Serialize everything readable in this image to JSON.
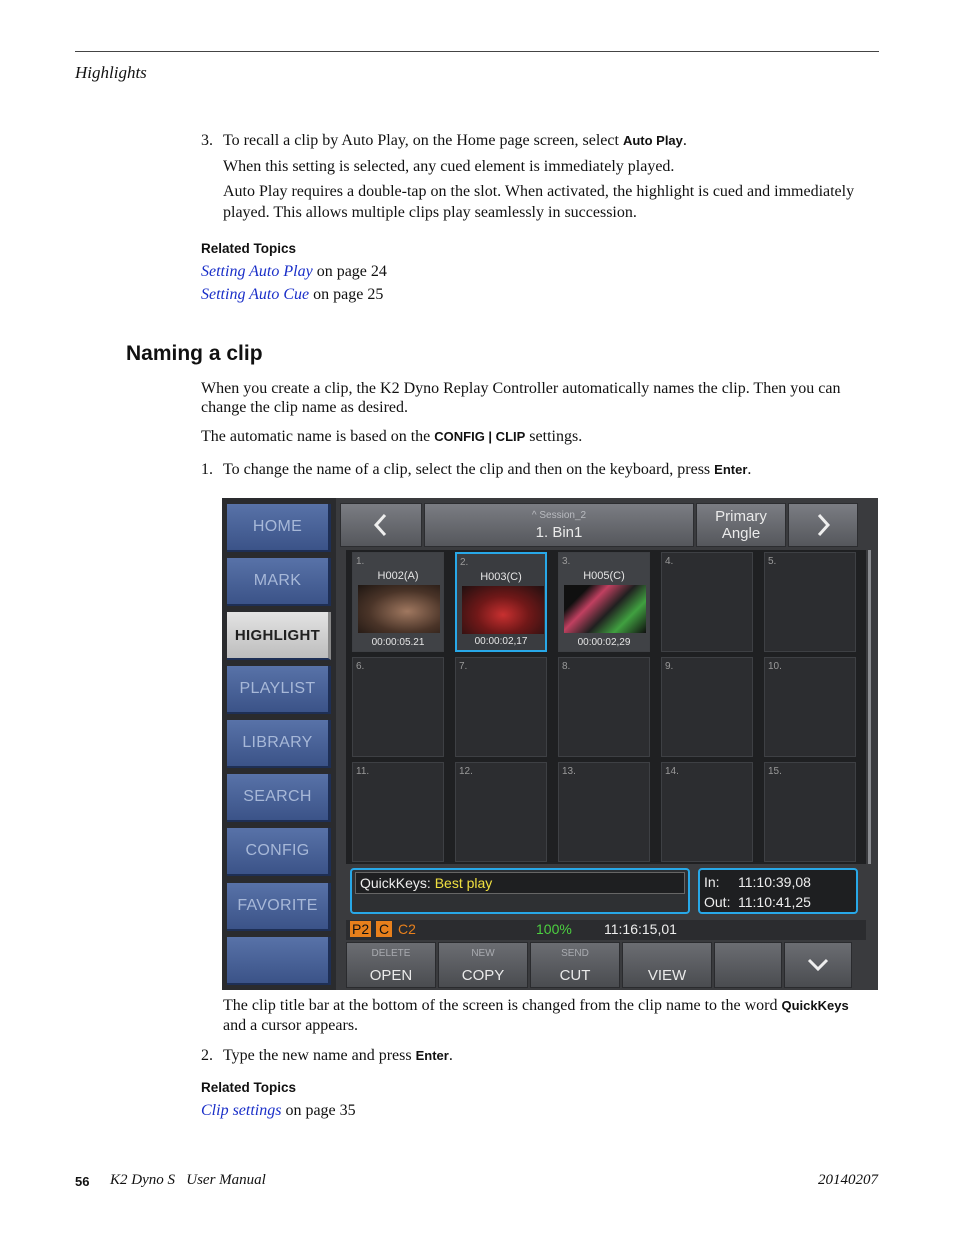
{
  "header": {
    "section": "Highlights"
  },
  "step3": {
    "num": "3.",
    "text_pre": "To recall a clip by Auto Play, on the Home page screen, select ",
    "text_kw": "Auto Play",
    "text_post": ".",
    "line2": "When this setting is selected, any cued element is immediately played.",
    "line3a": "Auto Play requires a double-tap on the slot. When activated, the highlight is cued and immediately",
    "line3b": "played. This allows multiple clips play seamlessly in succession."
  },
  "related1": {
    "title": "Related Topics",
    "links": [
      {
        "text": "Setting Auto Play",
        "suffix": " on page 24"
      },
      {
        "text": "Setting Auto Cue",
        "suffix": " on page 25"
      }
    ]
  },
  "heading": "Naming a clip",
  "intro": {
    "p1a": "When you create a clip, the K2 Dyno Replay Controller automatically names the clip. Then you can",
    "p1b": "change the clip name as desired.",
    "p2_pre": "The automatic name is based on the ",
    "p2_kw": "CONFIG | CLIP",
    "p2_post": " settings."
  },
  "step1": {
    "num": "1.",
    "text_pre": "To change the name of a clip, select the clip and then on the keyboard, press ",
    "text_kw": "Enter",
    "text_post": "."
  },
  "screenshot": {
    "nav": [
      "HOME",
      "MARK",
      "HIGHLIGHT",
      "PLAYLIST",
      "LIBRARY",
      "SEARCH",
      "CONFIG",
      "FAVORITE",
      ""
    ],
    "active_nav": "HIGHLIGHT",
    "session": "^ Session_2",
    "bin": "1. Bin1",
    "angle_line1": "Primary",
    "angle_line2": "Angle",
    "prev_icon": "chevron-left",
    "next_icon": "chevron-right",
    "slots": [
      {
        "num": "1.",
        "name": "H002(A)",
        "tc": "00:00:05.21"
      },
      {
        "num": "2.",
        "name": "H003(C)",
        "tc": "00:00:02,17"
      },
      {
        "num": "3.",
        "name": "H005(C)",
        "tc": "00:00:02,29"
      },
      {
        "num": "4."
      },
      {
        "num": "5."
      },
      {
        "num": "6."
      },
      {
        "num": "7."
      },
      {
        "num": "8."
      },
      {
        "num": "9."
      },
      {
        "num": "10."
      },
      {
        "num": "11."
      },
      {
        "num": "12."
      },
      {
        "num": "13."
      },
      {
        "num": "14."
      },
      {
        "num": "15."
      }
    ],
    "quickkeys_label": "QuickKeys:",
    "quickkeys_value": "Best play",
    "in_label": "In:",
    "in_value": "11:10:39,08",
    "out_label": "Out:",
    "out_value": "11:10:41,25",
    "status_p2": "P2",
    "status_c": "C",
    "status_c2": "C2",
    "status_pct": "100%",
    "status_tc": "11:16:15,01",
    "bottom": [
      {
        "small": "DELETE",
        "big": "OPEN"
      },
      {
        "small": "NEW",
        "big": "COPY"
      },
      {
        "small": "SEND",
        "big": "CUT"
      },
      {
        "small": "",
        "big": "VIEW"
      },
      {
        "small": "",
        "big": ""
      }
    ],
    "colors": {
      "accent": "#28a8e8",
      "nav_blue": "#4a64a0",
      "quickkeys_yellow": "#f0e040",
      "status_green": "#4cd040",
      "status_orange": "#e8801c"
    }
  },
  "after": {
    "p1a_pre": "The clip title bar at the bottom of the screen is changed from the clip name to the word ",
    "p1a_kw": "QuickKeys",
    "p1b": "and a cursor appears."
  },
  "step2": {
    "num": "2.",
    "text_pre": "Type the new name and press ",
    "text_kw": "Enter",
    "text_post": "."
  },
  "related2": {
    "title": "Related Topics",
    "link": "Clip settings",
    "suffix": " on page 35"
  },
  "footer": {
    "page": "56",
    "title": "K2 Dyno S   User Manual",
    "date": "20140207"
  }
}
